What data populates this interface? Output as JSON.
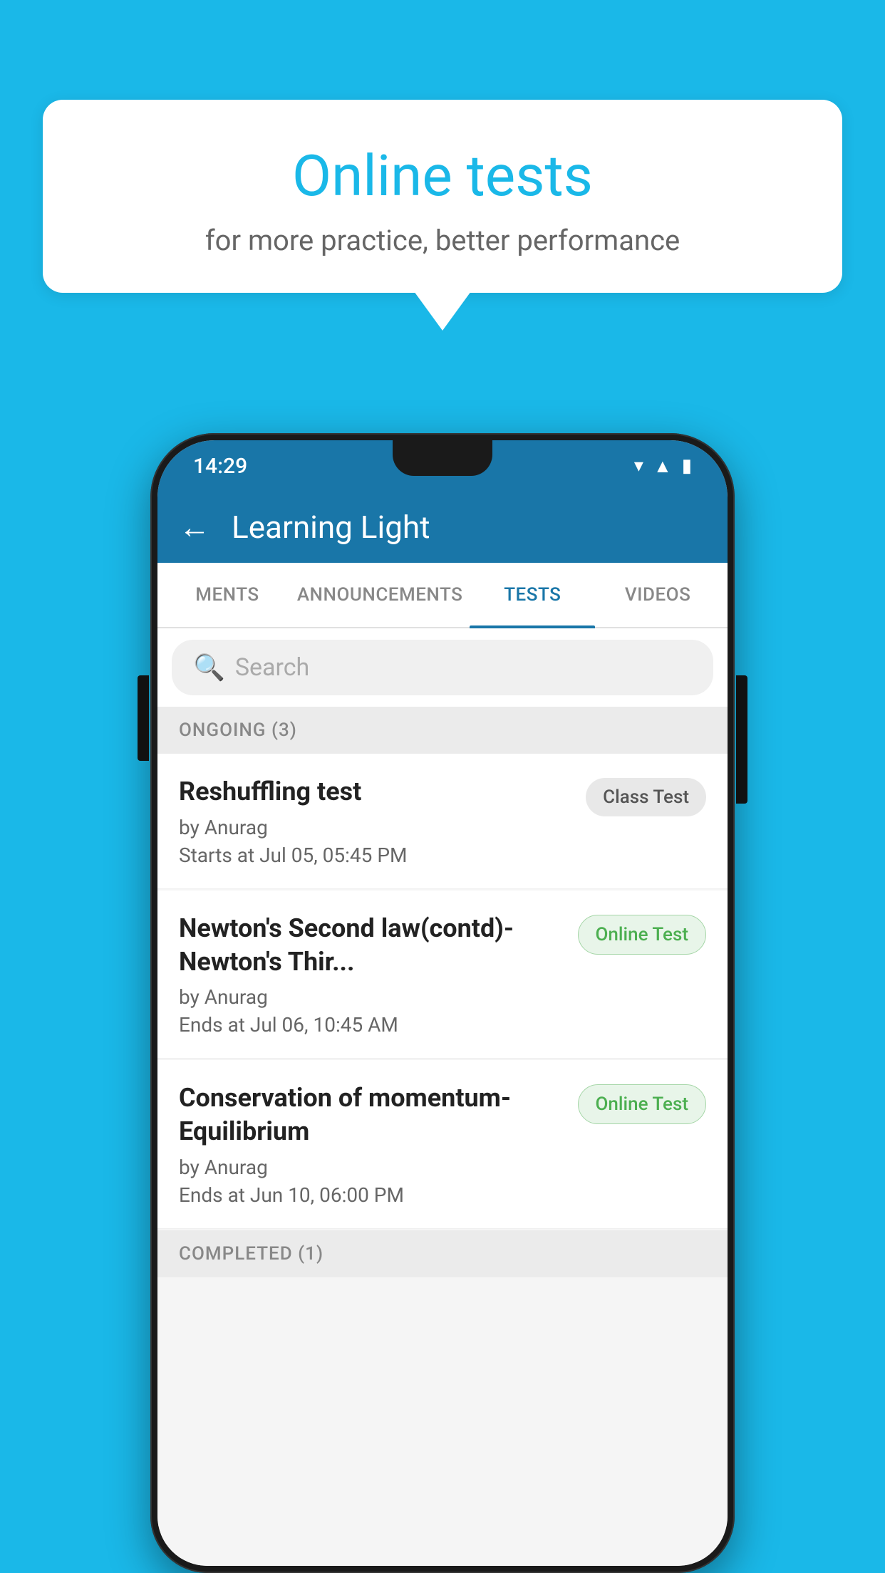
{
  "background": {
    "color": "#1ab8e8"
  },
  "speech_bubble": {
    "title": "Online tests",
    "subtitle": "for more practice, better performance"
  },
  "phone": {
    "status_bar": {
      "time": "14:29",
      "icons": [
        "wifi",
        "signal",
        "battery"
      ]
    },
    "app_bar": {
      "back_label": "←",
      "title": "Learning Light"
    },
    "tabs": [
      {
        "label": "MENTS",
        "active": false
      },
      {
        "label": "ANNOUNCEMENTS",
        "active": false
      },
      {
        "label": "TESTS",
        "active": true
      },
      {
        "label": "VIDEOS",
        "active": false
      }
    ],
    "search": {
      "placeholder": "Search"
    },
    "ongoing_section": {
      "header": "ONGOING (3)",
      "tests": [
        {
          "title": "Reshuffling test",
          "author": "by Anurag",
          "date": "Starts at  Jul 05, 05:45 PM",
          "badge": "Class Test",
          "badge_type": "class"
        },
        {
          "title": "Newton's Second law(contd)-Newton's Thir...",
          "author": "by Anurag",
          "date": "Ends at  Jul 06, 10:45 AM",
          "badge": "Online Test",
          "badge_type": "online"
        },
        {
          "title": "Conservation of momentum-Equilibrium",
          "author": "by Anurag",
          "date": "Ends at  Jun 10, 06:00 PM",
          "badge": "Online Test",
          "badge_type": "online"
        }
      ]
    },
    "completed_section": {
      "header": "COMPLETED (1)"
    }
  }
}
